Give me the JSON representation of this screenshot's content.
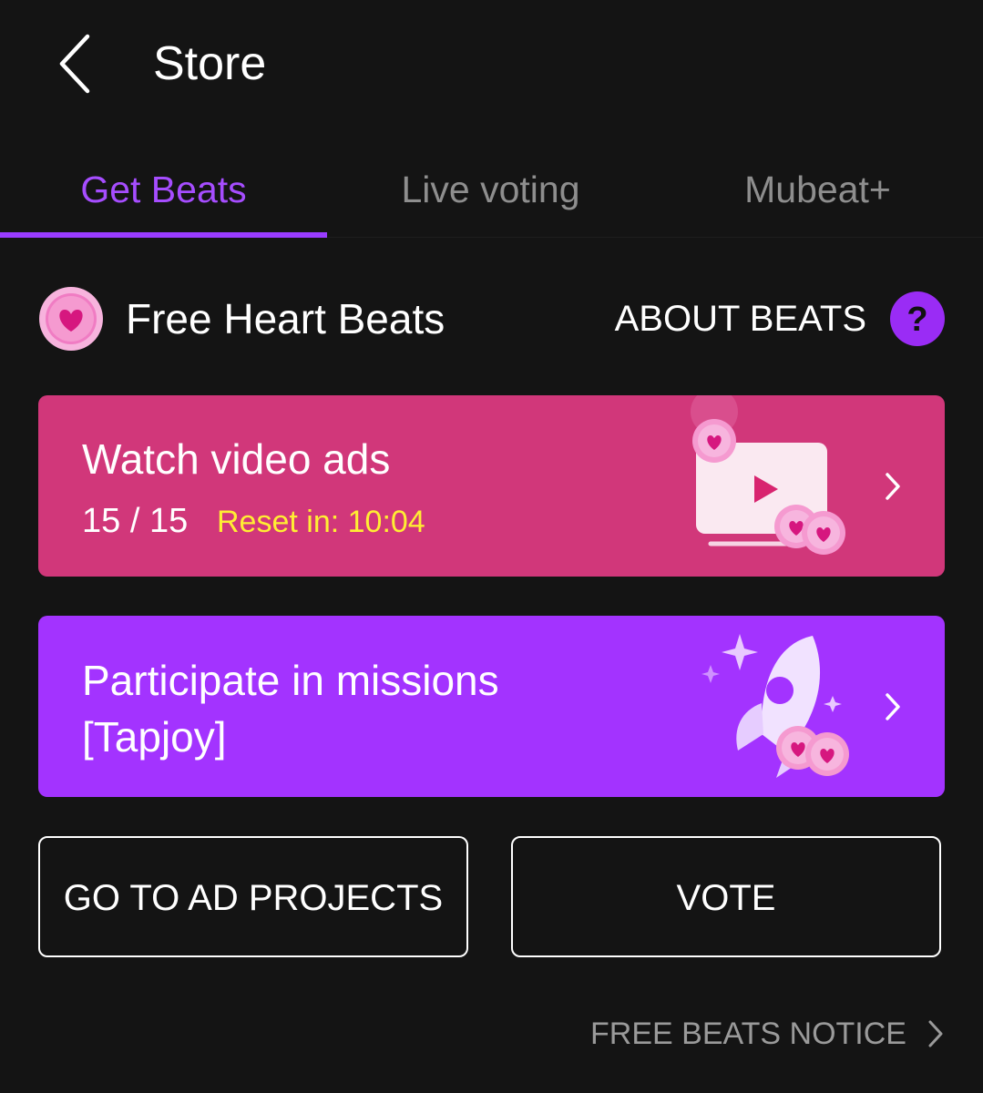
{
  "header": {
    "title": "Store",
    "back_icon": "chevron-left-icon"
  },
  "tabs": [
    {
      "label": "Get Beats",
      "active": true
    },
    {
      "label": "Live voting",
      "active": false
    },
    {
      "label": "Mubeat+",
      "active": false
    }
  ],
  "section": {
    "title": "Free Heart Beats",
    "icon": "heart-coin-icon",
    "about_label": "ABOUT BEATS",
    "help_icon": "question-mark-icon"
  },
  "cards": {
    "ads": {
      "title": "Watch video ads",
      "count": "15 / 15",
      "reset": "Reset in: 10:04",
      "illustration": "video-player-with-heart-coins",
      "background": "#d1377a"
    },
    "missions": {
      "title_line1": "Participate in missions",
      "title_line2": "[Tapjoy]",
      "illustration": "rocket-with-heart-coins",
      "background": "#a333ff"
    }
  },
  "buttons": {
    "ad_projects": "GO TO AD PROJECTS",
    "vote": "VOTE"
  },
  "notice": {
    "label": "FREE BEATS NOTICE"
  },
  "colors": {
    "accent": "#9a3cff",
    "reset_text": "#ffee33",
    "background": "#141414"
  }
}
